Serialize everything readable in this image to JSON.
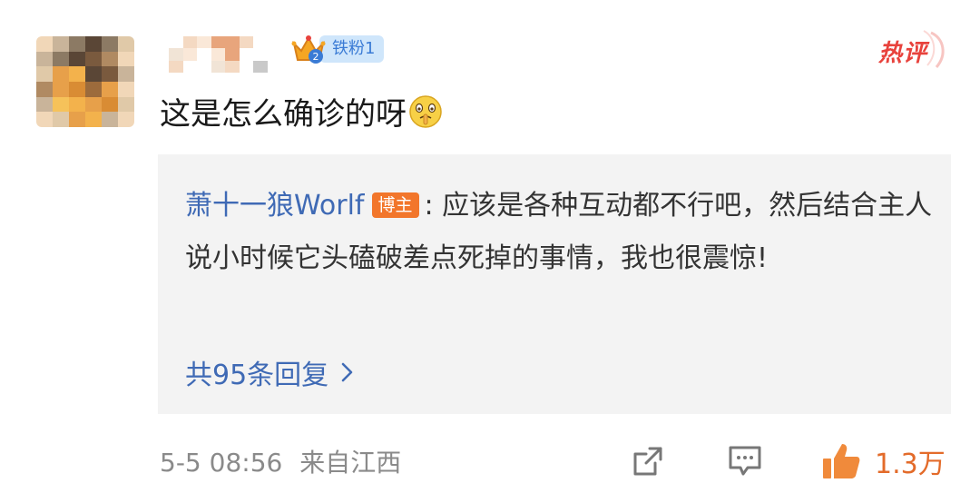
{
  "comment": {
    "badge_label": "铁粉1",
    "hot_label": "热评",
    "text": "这是怎么确诊的呀",
    "emoji": "shush-face",
    "reply": {
      "author": "萧十一狼Worlf",
      "author_badge": "博主",
      "separator": ":",
      "text": "应该是各种互动都不行吧，然后结合主人说小时候它头磕破差点死掉的事情，我也很震惊!",
      "more_label": "共95条回复"
    },
    "time": "5-5 08:56",
    "location": "来自江西",
    "likes": "1.3万",
    "icons": [
      "share-icon",
      "comment-icon",
      "like-icon",
      "chevron-right-icon",
      "crown-icon"
    ],
    "colors": {
      "link": "#3f6ab5",
      "like": "#e36b2a",
      "hot": "#e8423c",
      "author_badge": "#f2762b",
      "fan_badge": "#cfe6fb"
    }
  }
}
